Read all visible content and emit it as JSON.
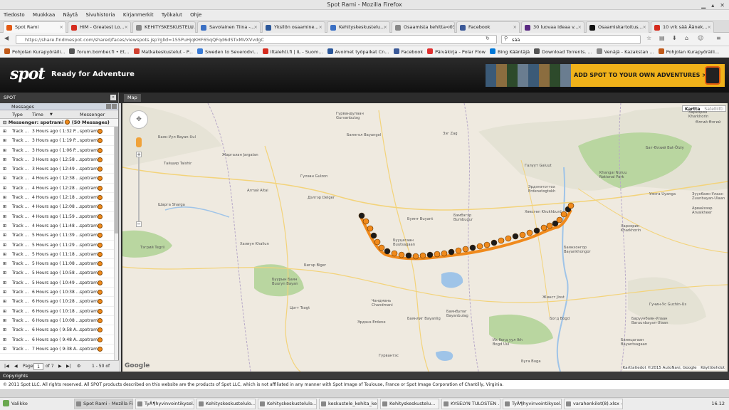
{
  "window": {
    "title": "Spot Rami - Mozilla Firefox"
  },
  "menu": [
    "Tiedosto",
    "Muokkaa",
    "Näytä",
    "Sivuhistoria",
    "Kirjanmerkit",
    "Työkalut",
    "Ohje"
  ],
  "tabs": [
    {
      "label": "Spot Rami",
      "active": true,
      "color": "#e35a14"
    },
    {
      "label": "HIM - Greatest Lo...",
      "active": false,
      "color": "#d52b1e"
    },
    {
      "label": "KEHITYSKESKUSTELU...",
      "active": false,
      "color": "#888888"
    },
    {
      "label": "Savolainen Tiina -...",
      "active": false,
      "color": "#3b70c4"
    },
    {
      "label": "Yksilön osaamine...",
      "active": false,
      "color": "#2b579a"
    },
    {
      "label": "Kehityskeskustelu...",
      "active": false,
      "color": "#3b70c4"
    },
    {
      "label": "Osaamista kehitta<03...",
      "active": false,
      "color": "#888888"
    },
    {
      "label": "Facebook",
      "active": false,
      "color": "#3b5998"
    },
    {
      "label": "30 luovaa ideaa v...",
      "active": false,
      "color": "#5a2a82"
    },
    {
      "label": "Osaamiskartoitus...",
      "active": false,
      "color": "#111111"
    },
    {
      "label": "10 vrk sää Äänek...",
      "active": false,
      "color": "#d52b1e"
    }
  ],
  "url": "https://share.findmespot.com/shared/faces/viewspots.jsp?glId=155PuHjqKHF65qQFqd6dSTxMVXVvdgC",
  "search": {
    "value": "sää"
  },
  "bookmarks": [
    "Pohjolan Kurapyöräili...",
    "forum.bomber.fi • Et...",
    "Matkakeskustelut - P...",
    "Sweden to Severodvi...",
    "Iltalehti.fi | IL - Suom...",
    "Avoimet työpaikat Cn...",
    "Facebook",
    "Päiväkirja - Polar Flow",
    "Bing Kääntäjä",
    "Download Torrents. ...",
    "Venäjä - Kazakstan ...",
    "Pohjolan Kurapyöräili..."
  ],
  "header": {
    "logo": "spot",
    "tagline": "Ready for Adventure",
    "banner": "ADD SPOT TO YOUR OWN ADVENTURES >>"
  },
  "panel": {
    "title": "SPOT",
    "messages_title": "Messages",
    "columns": [
      "Type",
      "Time",
      "Messenger"
    ],
    "group": "Messenger: spotrami",
    "group_count": "(50 Messages)",
    "rows": [
      {
        "type": "Track ...",
        "time": "3 Hours ago ( 1:32 P...",
        "messenger": "spotrami"
      },
      {
        "type": "Track ...",
        "time": "3 Hours ago ( 1:19 P...",
        "messenger": "spotrami"
      },
      {
        "type": "Track ...",
        "time": "3 Hours ago ( 1:06 P...",
        "messenger": "spotrami"
      },
      {
        "type": "Track ...",
        "time": "3 Hours ago ( 12:58 ...",
        "messenger": "spotrami"
      },
      {
        "type": "Track ...",
        "time": "3 Hours ago ( 12:49 ...",
        "messenger": "spotrami"
      },
      {
        "type": "Track ...",
        "time": "4 Hours ago ( 12:38 ...",
        "messenger": "spotrami"
      },
      {
        "type": "Track ...",
        "time": "4 Hours ago ( 12:28 ...",
        "messenger": "spotrami"
      },
      {
        "type": "Track ...",
        "time": "4 Hours ago ( 12:18 ...",
        "messenger": "spotrami"
      },
      {
        "type": "Track ...",
        "time": "4 Hours ago ( 12:08 ...",
        "messenger": "spotrami"
      },
      {
        "type": "Track ...",
        "time": "4 Hours ago ( 11:59 ...",
        "messenger": "spotrami"
      },
      {
        "type": "Track ...",
        "time": "4 Hours ago ( 11:48 ...",
        "messenger": "spotrami"
      },
      {
        "type": "Track ...",
        "time": "5 Hours ago ( 11:39 ...",
        "messenger": "spotrami"
      },
      {
        "type": "Track ...",
        "time": "5 Hours ago ( 11:29 ...",
        "messenger": "spotrami"
      },
      {
        "type": "Track ...",
        "time": "5 Hours ago ( 11:18 ...",
        "messenger": "spotrami"
      },
      {
        "type": "Track ...",
        "time": "5 Hours ago ( 11:08 ...",
        "messenger": "spotrami"
      },
      {
        "type": "Track ...",
        "time": "5 Hours ago ( 10:58 ...",
        "messenger": "spotrami"
      },
      {
        "type": "Track ...",
        "time": "5 Hours ago ( 10:49 ...",
        "messenger": "spotrami"
      },
      {
        "type": "Track ...",
        "time": "6 Hours ago ( 10:38 ...",
        "messenger": "spotrami"
      },
      {
        "type": "Track ...",
        "time": "6 Hours ago ( 10:28 ...",
        "messenger": "spotrami"
      },
      {
        "type": "Track ...",
        "time": "6 Hours ago ( 10:18 ...",
        "messenger": "spotrami"
      },
      {
        "type": "Track ...",
        "time": "6 Hours ago ( 10:08 ...",
        "messenger": "spotrami"
      },
      {
        "type": "Track ...",
        "time": "6 Hours ago ( 9:58 A...",
        "messenger": "spotrami"
      },
      {
        "type": "Track ...",
        "time": "6 Hours ago ( 9:48 A...",
        "messenger": "spotrami"
      },
      {
        "type": "Track ...",
        "time": "7 Hours ago ( 9:38 A...",
        "messenger": "spotrami"
      }
    ],
    "pager": {
      "page_label": "Page",
      "page_value": "1",
      "of": "of 7",
      "summary": "1 - 50 of 327"
    }
  },
  "map": {
    "tab": "Map",
    "type_map": "Kartta",
    "type_sat": "Satelliitti",
    "attribution": "Karttatiedot ©2015 AutoNavi, Google",
    "terms": "Käyttöehdot",
    "google": "Google",
    "places": [
      "Гурвандулаан Gurvanbulag",
      "Хархорин Kharkhorin",
      "Өлгий Өлгий",
      "Баян-Уул Bayan-Uul",
      "Баянгол Bayangol",
      "Жаргалан Jargalan",
      "Зэг Zag",
      "Бат-Өлзий Bat-Ölziy",
      "Khangai Nuruu National Park",
      "Тайшир Taishir",
      "Гүлзөн Gulzon",
      "Галуут Galuut",
      "Эрдэнэтогтох Erdenetogtokh",
      "Алтай Altai",
      "Дэлгэр Delger",
      "Хөвсгөл Khukhburd",
      "Уянга Uyanga",
      "Зүүнбаян-Улаан Zuunbayan-Ulaan",
      "Шарга Sharga",
      "Буянт Buyant",
      "Бууцагаан Buutsagaan",
      "Бэмбэгэр Bumbugur",
      "Арвайхээр Arvaikheer",
      "Халиун Khaliun",
      "Хархорин Kharkhorin",
      "Тэгрий Tegrii",
      "Бигэр Biger",
      "Баянхонгор Bayankhongor",
      "Баянлиг Bayanlig",
      "Буурын Баян Buuryn Bayan",
      "Жинст Jinst",
      "Богд Bogd",
      "Цогт Tsogt",
      "Чандмань Chandmani",
      "Баянбулаг Bayanbulag",
      "Баруунбаян-Улаан Baruunbayan-Ulaan",
      "Эрдэнэ Erdene",
      "Баянцагаан Bayantsagaan",
      "Гучин-Ус Guchin-Us",
      "Их богд уул Ikh Bogd Uul",
      "Буга Buga",
      "Гурвантэс"
    ]
  },
  "footer": {
    "title": "Copyrights",
    "text": "© 2011 Spot LLC. All rights reserved. All SPOT products described on this website are the products of Spot LLC, which is not affiliated in any manner with Spot Image of Toulouse, France or Spot Image Corporation of Chantilly, Virginia."
  },
  "taskbar": {
    "start": "Valikko",
    "items": [
      {
        "label": "Spot Rami - Mozilla Fi...",
        "active": true
      },
      {
        "label": "TyÃ¶hyvinvointikysel...",
        "active": false
      },
      {
        "label": "Kehityskeskustelulo...",
        "active": false
      },
      {
        "label": "Kehityskeskustelulo...",
        "active": false
      },
      {
        "label": "keskustele_kehita_ke...",
        "active": false
      },
      {
        "label": "Kehityskeskustelu...",
        "active": false
      },
      {
        "label": "KYSELYN TULOSTEN ...",
        "active": false
      },
      {
        "label": "TyÃ¶hyvinvointikysel...",
        "active": false
      },
      {
        "label": "varahenkilot(8).xlsx - ...",
        "active": false
      }
    ],
    "clock": "16.12"
  },
  "colors": {
    "track_orange": "#f08a1c",
    "spot_black": "#1a1a1a",
    "banner_yellow": "#f0b21a"
  }
}
